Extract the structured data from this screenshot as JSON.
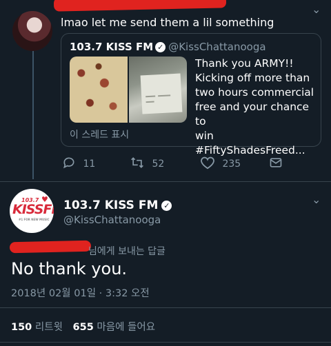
{
  "quote_tweet": {
    "reply_text": "lmao let me send them a lil something"
  },
  "quoted_tweet": {
    "name": "103.7 KISS FM",
    "handle": "@KissChattanooga",
    "lines": [
      "Thank you ARMY!!",
      "Kicking off more than",
      "two hours commercial",
      "free and your chance to",
      "win #FiftyShadesFreed..."
    ],
    "show_thread": "이 스레드 표시"
  },
  "actions": {
    "replies": "11",
    "retweets": "52",
    "likes": "235"
  },
  "main_tweet": {
    "name": "103.7 KISS FM",
    "handle": "@KissChattanooga",
    "replying_to": "님에게 보내는 답글",
    "text": "No thank you.",
    "timestamp": "2018년 02월 01일 · 3:32 오전"
  },
  "avatar_logo": {
    "freq": "103.7",
    "brand": "KISSFM",
    "tagline": "#1 FOR NEW MUSIC"
  },
  "stats": {
    "retweets_count": "150",
    "retweets_label": "리트윗",
    "likes_count": "655",
    "likes_label": "마음에 들어요"
  },
  "icons": {
    "reply": "reply-icon",
    "retweet": "retweet-icon",
    "like": "heart-icon",
    "share": "share-icon",
    "verified": "verified-badge-icon",
    "caret": "chevron-down-icon"
  },
  "colors": {
    "background": "#141d26",
    "secondary_text": "#8899a6",
    "border": "#38444d",
    "brand_red": "#d82a3a",
    "redaction": "#e0231f"
  }
}
